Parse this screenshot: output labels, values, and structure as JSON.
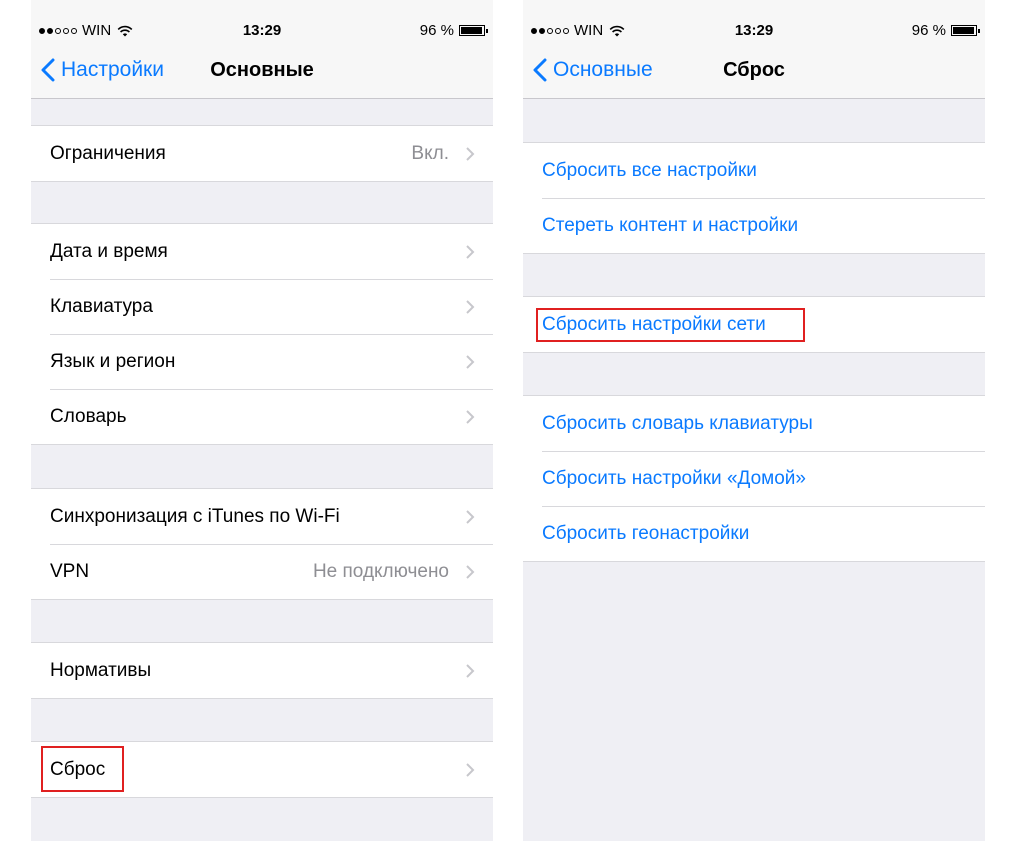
{
  "status": {
    "carrier": "WIN",
    "time": "13:29",
    "battery": "96 %"
  },
  "left": {
    "back_label": "Настройки",
    "title": "Основные",
    "groups": [
      [
        {
          "label": "Ограничения",
          "value": "Вкл."
        }
      ],
      [
        {
          "label": "Дата и время"
        },
        {
          "label": "Клавиатура"
        },
        {
          "label": "Язык и регион"
        },
        {
          "label": "Словарь"
        }
      ],
      [
        {
          "label": "Синхронизация с iTunes по Wi-Fi"
        },
        {
          "label": "VPN",
          "value": "Не подключено"
        }
      ],
      [
        {
          "label": "Нормативы"
        }
      ],
      [
        {
          "label": "Сброс"
        }
      ]
    ]
  },
  "right": {
    "back_label": "Основные",
    "title": "Сброс",
    "groups": [
      [
        {
          "label": "Сбросить все настройки"
        },
        {
          "label": "Стереть контент и настройки"
        }
      ],
      [
        {
          "label": "Сбросить настройки сети"
        }
      ],
      [
        {
          "label": "Сбросить словарь клавиатуры"
        },
        {
          "label": "Сбросить настройки «Домой»"
        },
        {
          "label": "Сбросить геонастройки"
        }
      ]
    ]
  },
  "colors": {
    "accent": "#0a7aff",
    "highlight": "#e02020",
    "background": "#efeff4"
  }
}
